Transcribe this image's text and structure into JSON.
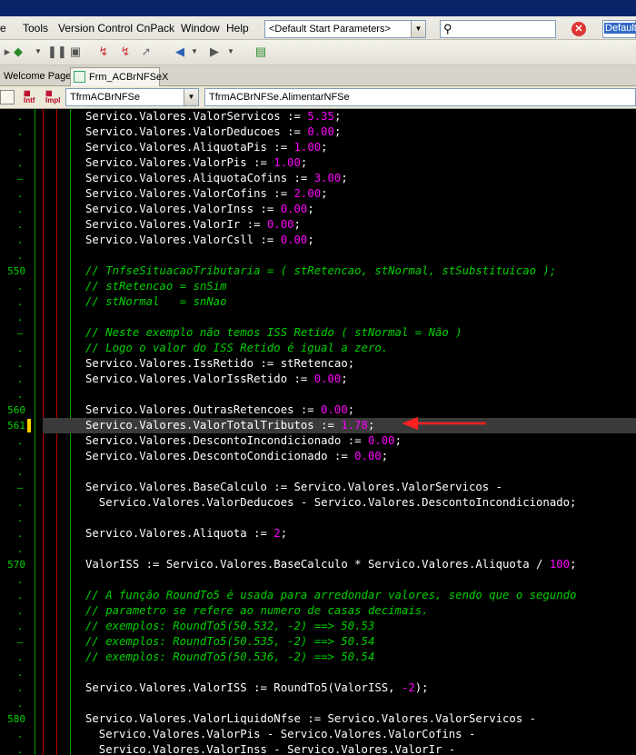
{
  "menu": {
    "items": [
      "Tools",
      "Version Control",
      "CnPack",
      "Window",
      "Help"
    ],
    "file_partial": "e"
  },
  "params_combo": "<Default Start Parameters>",
  "search_value": "",
  "layout_combo": "Default",
  "tabs": [
    "Welcome Page",
    "Frm_ACBrNFSeX"
  ],
  "class_combo": "TfrmACBrNFSe",
  "method_combo": "TfrmACBrNFSe.AlimentarNFSe",
  "code_lines": [
    {
      "ln": "",
      "marker": ".",
      "segs": [
        [
          "Servico.Valores.ValorServicos := ",
          "p"
        ],
        [
          "5.35",
          "n"
        ],
        [
          ";",
          "p"
        ]
      ]
    },
    {
      "ln": "",
      "marker": ".",
      "segs": [
        [
          "Servico.Valores.ValorDeducoes := ",
          "p"
        ],
        [
          "0.00",
          "n"
        ],
        [
          ";",
          "p"
        ]
      ]
    },
    {
      "ln": "",
      "marker": ".",
      "segs": [
        [
          "Servico.Valores.AliquotaPis := ",
          "p"
        ],
        [
          "1.00",
          "n"
        ],
        [
          ";",
          "p"
        ]
      ]
    },
    {
      "ln": "",
      "marker": ".",
      "segs": [
        [
          "Servico.Valores.ValorPis := ",
          "p"
        ],
        [
          "1.00",
          "n"
        ],
        [
          ";",
          "p"
        ]
      ]
    },
    {
      "ln": "",
      "marker": "–",
      "segs": [
        [
          "Servico.Valores.AliquotaCofins := ",
          "p"
        ],
        [
          "3.00",
          "n"
        ],
        [
          ";",
          "p"
        ]
      ]
    },
    {
      "ln": "",
      "marker": ".",
      "segs": [
        [
          "Servico.Valores.ValorCofins := ",
          "p"
        ],
        [
          "2.00",
          "n"
        ],
        [
          ";",
          "p"
        ]
      ]
    },
    {
      "ln": "",
      "marker": ".",
      "segs": [
        [
          "Servico.Valores.ValorInss := ",
          "p"
        ],
        [
          "0.00",
          "n"
        ],
        [
          ";",
          "p"
        ]
      ]
    },
    {
      "ln": "",
      "marker": ".",
      "segs": [
        [
          "Servico.Valores.ValorIr := ",
          "p"
        ],
        [
          "0.00",
          "n"
        ],
        [
          ";",
          "p"
        ]
      ]
    },
    {
      "ln": "",
      "marker": ".",
      "segs": [
        [
          "Servico.Valores.ValorCsll := ",
          "p"
        ],
        [
          "0.00",
          "n"
        ],
        [
          ";",
          "p"
        ]
      ]
    },
    {
      "ln": "",
      "marker": ".",
      "segs": []
    },
    {
      "ln": "550",
      "marker": "",
      "segs": [
        [
          "// TnfseSituacaoTributaria = ( stRetencao, stNormal, stSubstituicao );",
          "c"
        ]
      ]
    },
    {
      "ln": "",
      "marker": ".",
      "segs": [
        [
          "// stRetencao = snSim",
          "c"
        ]
      ]
    },
    {
      "ln": "",
      "marker": ".",
      "segs": [
        [
          "// stNormal   = snNao",
          "c"
        ]
      ]
    },
    {
      "ln": "",
      "marker": ".",
      "segs": []
    },
    {
      "ln": "",
      "marker": "–",
      "segs": [
        [
          "// Neste exemplo não temos ISS Retido ( stNormal = Não )",
          "c"
        ]
      ]
    },
    {
      "ln": "",
      "marker": ".",
      "segs": [
        [
          "// Logo o valor do ISS Retido é igual a zero.",
          "c"
        ]
      ]
    },
    {
      "ln": "",
      "marker": ".",
      "segs": [
        [
          "Servico.Valores.IssRetido := stRetencao;",
          "p"
        ]
      ]
    },
    {
      "ln": "",
      "marker": ".",
      "segs": [
        [
          "Servico.Valores.ValorIssRetido := ",
          "p"
        ],
        [
          "0.00",
          "n"
        ],
        [
          ";",
          "p"
        ]
      ]
    },
    {
      "ln": "",
      "marker": ".",
      "segs": []
    },
    {
      "ln": "560",
      "marker": "",
      "segs": [
        [
          "Servico.Valores.OutrasRetencoes := ",
          "p"
        ],
        [
          "0.00",
          "n"
        ],
        [
          ";",
          "p"
        ]
      ]
    },
    {
      "ln": "561",
      "marker": "",
      "current": true,
      "segs": [
        [
          "Servico.Valores.ValorTotalTributos := ",
          "p"
        ],
        [
          "1.78",
          "n"
        ],
        [
          ";",
          "p"
        ]
      ]
    },
    {
      "ln": "",
      "marker": ".",
      "segs": [
        [
          "Servico.Valores.DescontoIncondicionado := ",
          "p"
        ],
        [
          "0.00",
          "n"
        ],
        [
          ";",
          "p"
        ]
      ]
    },
    {
      "ln": "",
      "marker": ".",
      "segs": [
        [
          "Servico.Valores.DescontoCondicionado := ",
          "p"
        ],
        [
          "0.00",
          "n"
        ],
        [
          ";",
          "p"
        ]
      ]
    },
    {
      "ln": "",
      "marker": ".",
      "segs": []
    },
    {
      "ln": "",
      "marker": "–",
      "segs": [
        [
          "Servico.Valores.BaseCalculo := Servico.Valores.ValorServicos -",
          "p"
        ]
      ]
    },
    {
      "ln": "",
      "marker": ".",
      "segs": [
        [
          "  Servico.Valores.ValorDeducoes - Servico.Valores.DescontoIncondicionado;",
          "p"
        ]
      ]
    },
    {
      "ln": "",
      "marker": ".",
      "segs": []
    },
    {
      "ln": "",
      "marker": ".",
      "segs": [
        [
          "Servico.Valores.Aliquota := ",
          "p"
        ],
        [
          "2",
          "n"
        ],
        [
          ";",
          "p"
        ]
      ]
    },
    {
      "ln": "",
      "marker": ".",
      "segs": []
    },
    {
      "ln": "570",
      "marker": "",
      "segs": [
        [
          "ValorISS := Servico.Valores.BaseCalculo * Servico.Valores.Aliquota / ",
          "p"
        ],
        [
          "100",
          "n"
        ],
        [
          ";",
          "p"
        ]
      ]
    },
    {
      "ln": "",
      "marker": ".",
      "segs": []
    },
    {
      "ln": "",
      "marker": ".",
      "segs": [
        [
          "// A função RoundTo5 é usada para arredondar valores, sendo que o segundo",
          "c"
        ]
      ]
    },
    {
      "ln": "",
      "marker": ".",
      "segs": [
        [
          "// parametro se refere ao numero de casas decimais.",
          "c"
        ]
      ]
    },
    {
      "ln": "",
      "marker": ".",
      "segs": [
        [
          "// exemplos: RoundTo5(50.532, -2) ==> 50.53",
          "c"
        ]
      ]
    },
    {
      "ln": "",
      "marker": "–",
      "segs": [
        [
          "// exemplos: RoundTo5(50.535, -2) ==> 50.54",
          "c"
        ]
      ]
    },
    {
      "ln": "",
      "marker": ".",
      "segs": [
        [
          "// exemplos: RoundTo5(50.536, -2) ==> 50.54",
          "c"
        ]
      ]
    },
    {
      "ln": "",
      "marker": ".",
      "segs": []
    },
    {
      "ln": "",
      "marker": ".",
      "segs": [
        [
          "Servico.Valores.ValorISS := RoundTo5(ValorISS, ",
          "p"
        ],
        [
          "-2",
          "n"
        ],
        [
          ");",
          "p"
        ]
      ]
    },
    {
      "ln": "",
      "marker": ".",
      "segs": []
    },
    {
      "ln": "580",
      "marker": "",
      "segs": [
        [
          "Servico.Valores.ValorLiquidoNfse := Servico.Valores.ValorServicos -",
          "p"
        ]
      ]
    },
    {
      "ln": "",
      "marker": ".",
      "segs": [
        [
          "  Servico.Valores.ValorPis - Servico.Valores.ValorCofins -",
          "p"
        ]
      ]
    },
    {
      "ln": "",
      "marker": ".",
      "segs": [
        [
          "  Servico.Valores.ValorInss - Servico.Valores.ValorIr -",
          "p"
        ]
      ]
    }
  ]
}
